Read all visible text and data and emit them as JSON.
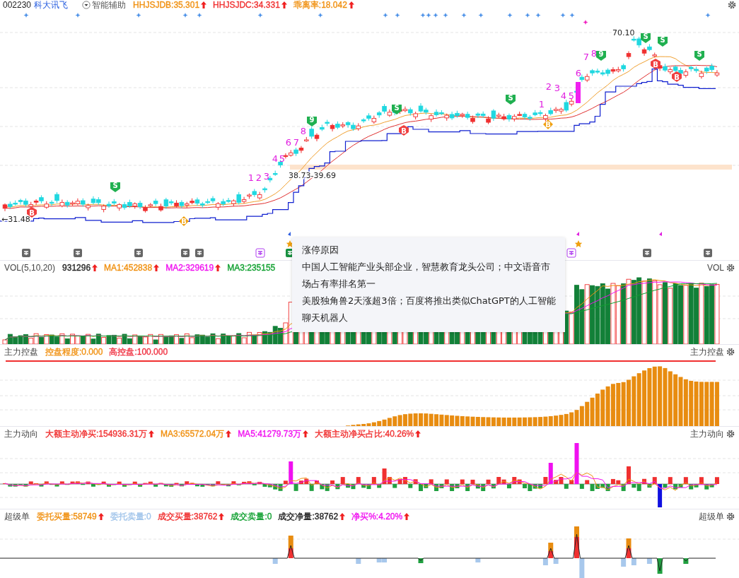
{
  "header": {
    "code": "002230",
    "name": "科大讯飞",
    "assist": "智能辅助",
    "indicators": [
      {
        "text": "HHJSJDB:35.301",
        "color": "#f09010",
        "arrow": true
      },
      {
        "text": "HHJSJDC:34.331",
        "color": "#f03030",
        "arrow": true
      },
      {
        "text": "乖离率:18.042",
        "color": "#f09010",
        "arrow": true
      }
    ]
  },
  "main_chart": {
    "price_labels": [
      "←31.48",
      "38.73-39.69",
      "70.10"
    ],
    "signals": [
      {
        "kind": "buy",
        "text": "B"
      },
      {
        "kind": "sell",
        "text": "S"
      },
      {
        "kind": "buy_alt",
        "text": "B"
      },
      {
        "kind": "nine",
        "text": "9"
      },
      {
        "kind": "sell",
        "text": "S"
      },
      {
        "kind": "buy",
        "text": "B"
      },
      {
        "kind": "sell",
        "text": "S"
      },
      {
        "kind": "buy_alt",
        "text": "B"
      },
      {
        "kind": "nine",
        "text": "9"
      },
      {
        "kind": "sell",
        "text": "S"
      },
      {
        "kind": "buy",
        "text": "B"
      },
      {
        "kind": "sell",
        "text": "S"
      },
      {
        "kind": "buy",
        "text": "B"
      },
      {
        "kind": "sell",
        "text": "S"
      }
    ],
    "counts": [
      "1",
      "2",
      "3",
      "4",
      "5",
      "6",
      "7",
      "8",
      "1",
      "2",
      "3",
      "4",
      "5",
      "6",
      "7",
      "8"
    ]
  },
  "tooltip": {
    "title": "涨停原因",
    "paragraphs": [
      "中国人工智能产业头部企业，智慧教育龙头公司；中文语音市场占有率排名第一",
      "美股独角兽2天涨超3倍；百度将推出类似ChatGPT的人工智能聊天机器人"
    ]
  },
  "panels": [
    {
      "kind": "volume",
      "title": "VOL(5,10,20)",
      "right_label": "VOL",
      "indicators": [
        {
          "text": "931296",
          "color": "#222222",
          "arrow": true
        },
        {
          "text": "MA1:452838",
          "color": "#f09010",
          "arrow": true
        },
        {
          "text": "MA2:329619",
          "color": "#f010f0",
          "arrow": true
        },
        {
          "text": "MA3:235155",
          "color": "#10a030",
          "arrow": false
        }
      ]
    },
    {
      "kind": "control",
      "title": "主力控盘",
      "right_label": "主力控盘",
      "indicators": [
        {
          "text": "控盘程度:0.000",
          "color": "#f09010",
          "arrow": false
        },
        {
          "text": "高控盘:100.000",
          "color": "#f03040",
          "arrow": false
        }
      ]
    },
    {
      "kind": "flow",
      "title": "主力动向",
      "right_label": "主力动向",
      "indicators": [
        {
          "text": "大额主动净买:154936.31万",
          "color": "#f03030",
          "arrow": true
        },
        {
          "text": "MA3:65572.04万",
          "color": "#f09010",
          "arrow": true
        },
        {
          "text": "MA5:41279.73万",
          "color": "#f010f0",
          "arrow": true
        },
        {
          "text": "大额主动净买占比:40.26%",
          "color": "#f03030",
          "arrow": true
        }
      ]
    },
    {
      "kind": "super",
      "title": "超级单",
      "right_label": "超级单",
      "indicators": [
        {
          "text": "委托买量:58749",
          "color": "#f09010",
          "arrow": true
        },
        {
          "text": "委托卖量:0",
          "color": "#a0c4ea",
          "arrow": false
        },
        {
          "text": "成交买量:38762",
          "color": "#f03030",
          "arrow": true
        },
        {
          "text": "成交卖量:0",
          "color": "#10a030",
          "arrow": false
        },
        {
          "text": "成交净量:38762",
          "color": "#222222",
          "arrow": true
        },
        {
          "text": "净买%:4.20%",
          "color": "#f010f0",
          "arrow": true
        }
      ]
    }
  ]
}
